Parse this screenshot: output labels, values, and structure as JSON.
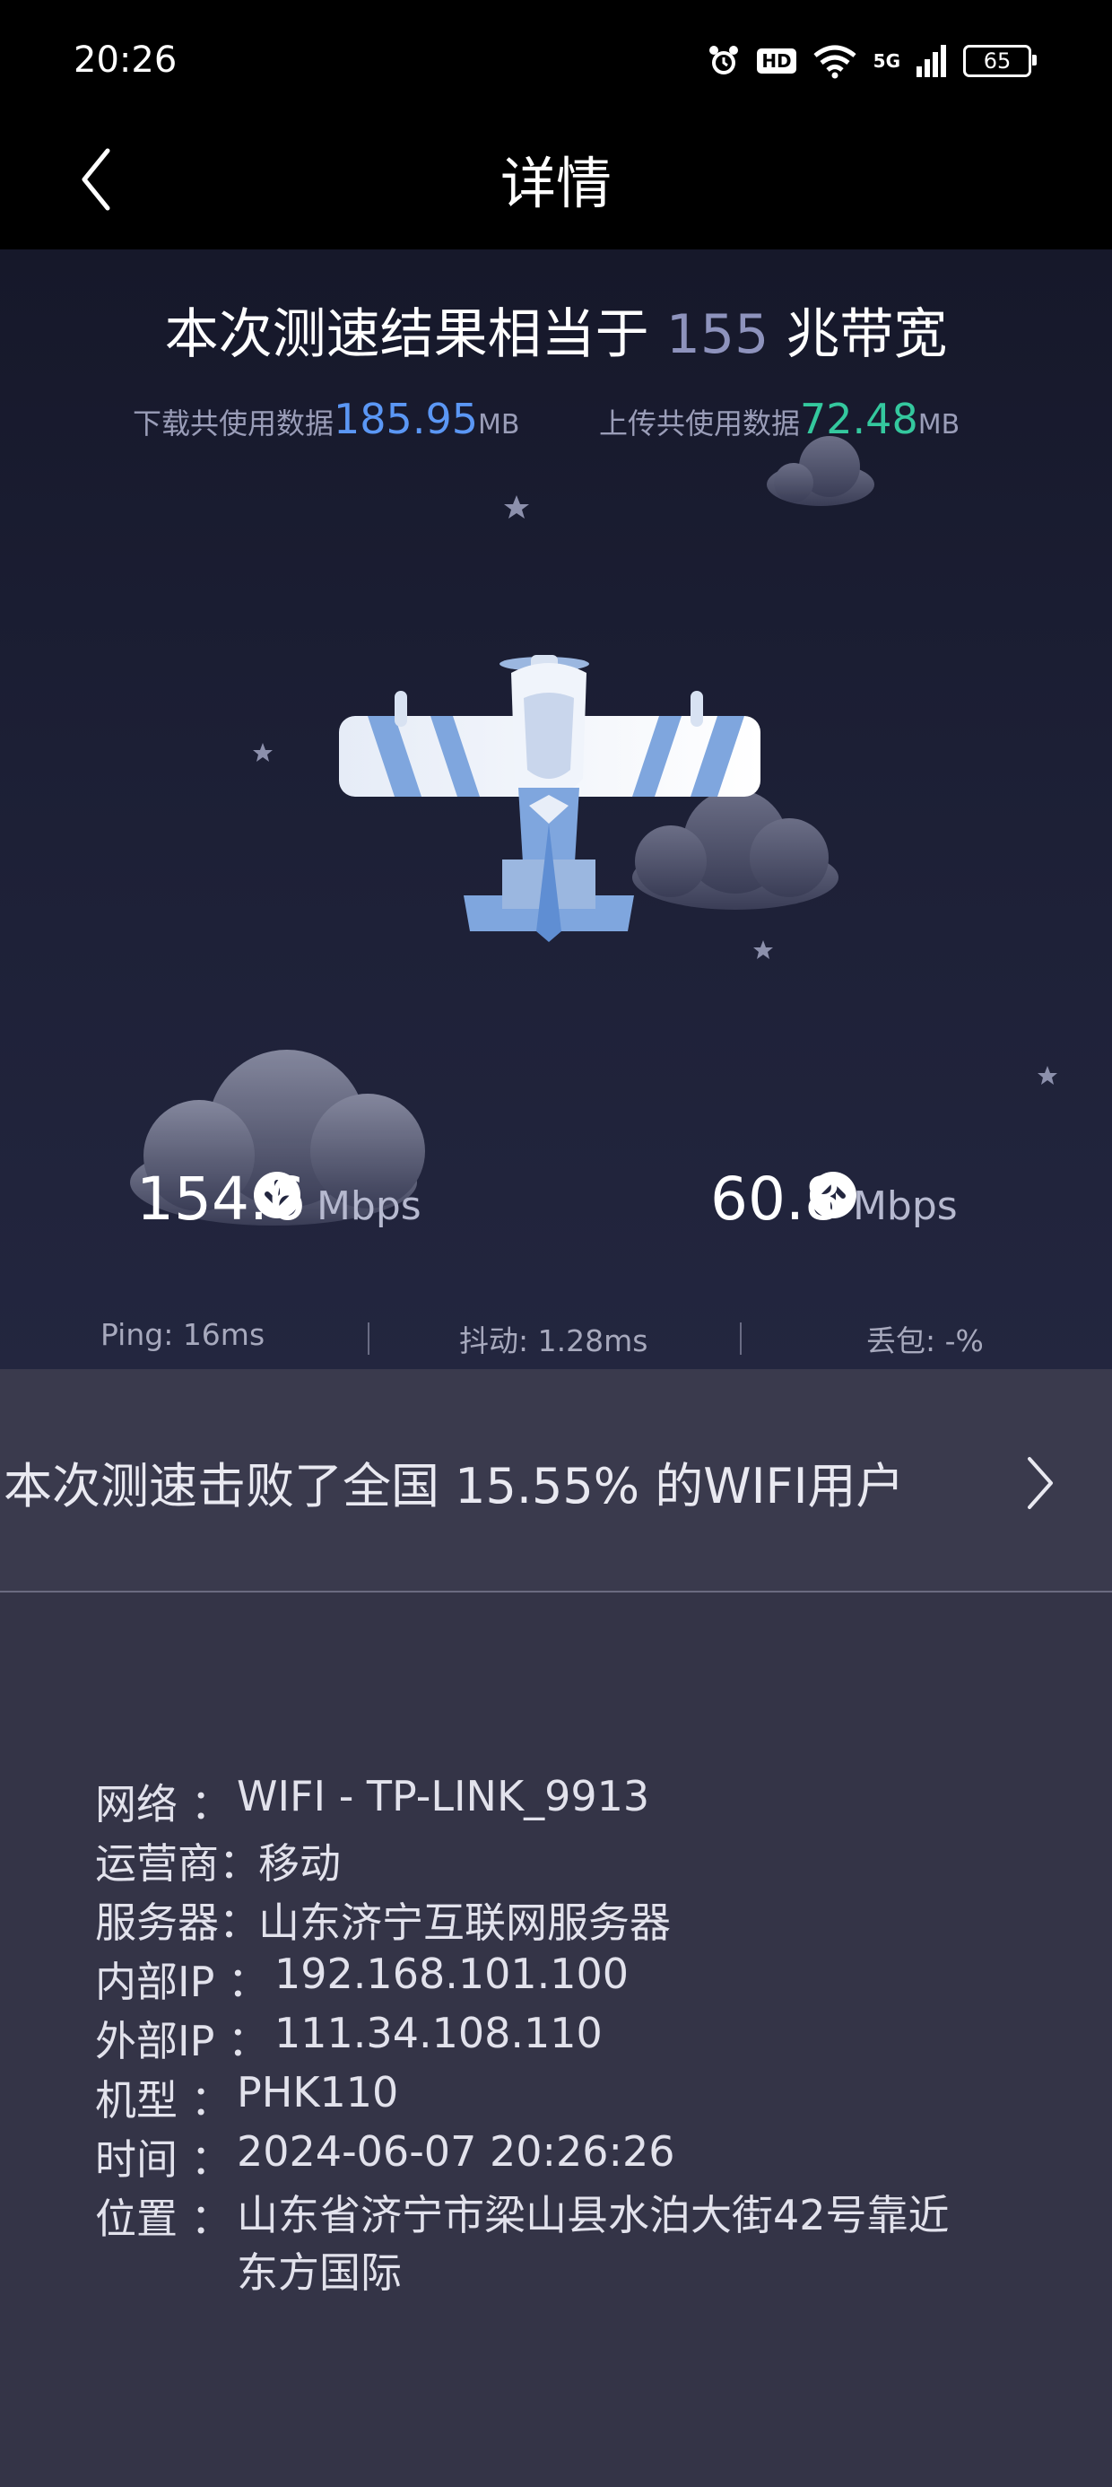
{
  "status_bar": {
    "time": "20:26",
    "signal_label": "5G",
    "hd_label": "HD",
    "battery": "65"
  },
  "nav": {
    "title": "详情"
  },
  "result": {
    "headline_prefix": "本次测速结果相当于",
    "bandwidth": "155",
    "headline_suffix": "兆带宽",
    "download_data_label": "下载共使用数据",
    "download_data_value": "185.95",
    "download_data_unit": "MB",
    "upload_data_label": "上传共使用数据",
    "upload_data_value": "72.48",
    "upload_data_unit": "MB"
  },
  "speeds": {
    "download_value": "154.6",
    "download_unit": "Mbps",
    "upload_value": "60.8",
    "upload_unit": "Mbps"
  },
  "metrics": {
    "ping": "Ping:  16ms",
    "jitter": "抖动:  1.28ms",
    "loss": "丢包:  -%"
  },
  "rank": {
    "text": "本次测速击败了全国 15.55% 的WIFI用户"
  },
  "details": [
    {
      "label": "网络 ：",
      "value": "WIFI - TP-LINK_9913"
    },
    {
      "label": "运营商：",
      "value": "移动"
    },
    {
      "label": "服务器：",
      "value": "山东济宁互联网服务器"
    },
    {
      "label": "内部IP ：",
      "value": "192.168.101.100"
    },
    {
      "label": "外部IP ：",
      "value": "111.34.108.110"
    },
    {
      "label": "机型 ：",
      "value": "PHK110"
    },
    {
      "label": "时间 ：",
      "value": "2024-06-07 20:26:26"
    },
    {
      "label": "位置 ：",
      "value": "山东省济宁市梁山县水泊大街42号靠近东方国际"
    }
  ],
  "colors": {
    "download_accent": "#5b97f5",
    "upload_accent": "#34c89e",
    "bandwidth_accent": "#8e93bd",
    "background": "#343447"
  }
}
